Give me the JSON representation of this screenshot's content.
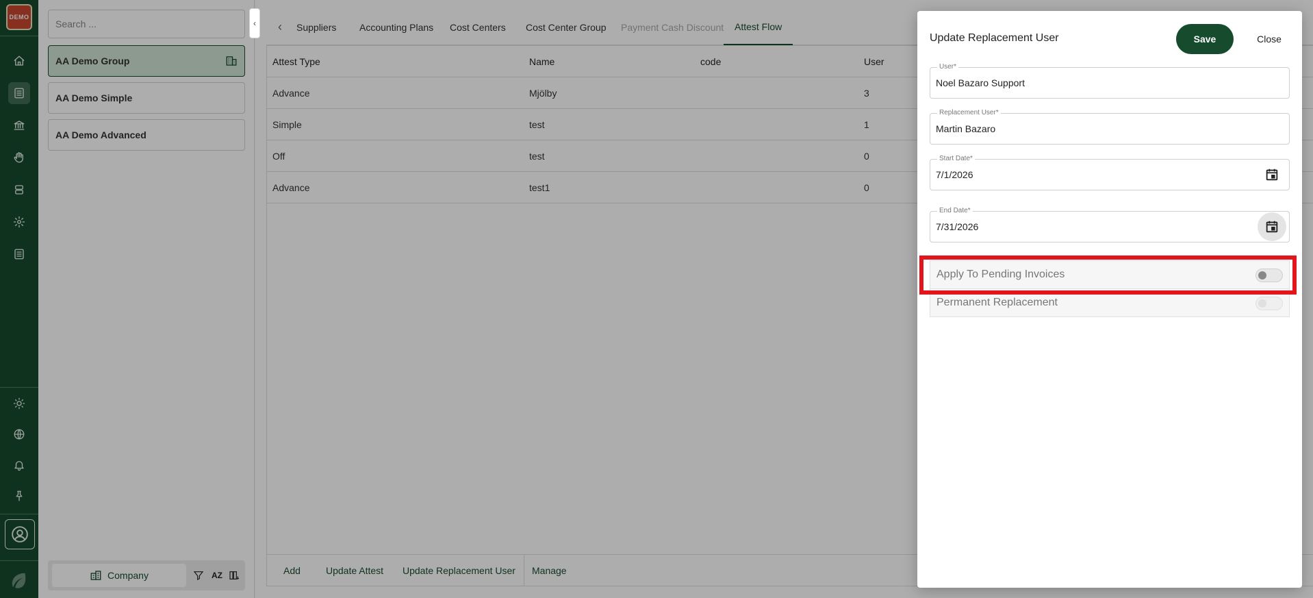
{
  "rail": {
    "logo_text": "DEMO",
    "top_icons": [
      "home-icon",
      "document-icon",
      "bank-icon",
      "hand-icon",
      "database-icon",
      "gear-icon",
      "list-icon"
    ],
    "bottom_icons": [
      "sun-icon",
      "globe-icon",
      "bell-icon",
      "pin-icon"
    ],
    "active_icon": "document-icon"
  },
  "list": {
    "search_placeholder": "Search ...",
    "collapse_glyph": "‹",
    "companies": [
      {
        "name": "AA Demo Group",
        "selected": true
      },
      {
        "name": "AA Demo Simple",
        "selected": false
      },
      {
        "name": "AA Demo Advanced",
        "selected": false
      }
    ],
    "footer": {
      "company_label": "Company",
      "sort_label": "AZ"
    }
  },
  "tabs": {
    "prev_glyph": "‹",
    "items": [
      "Suppliers",
      "Accounting Plans",
      "Cost Centers",
      "Cost Center Group",
      "Payment Cash Discount",
      "Attest Flow"
    ],
    "active": "Attest Flow",
    "disabled": "Payment Cash Discount"
  },
  "table": {
    "columns": [
      "Attest Type",
      "Name",
      "code",
      "User"
    ],
    "rows": [
      [
        "Advance",
        "Mjölby",
        "",
        "3"
      ],
      [
        "Simple",
        "test",
        "",
        "1"
      ],
      [
        "Off",
        "test",
        "",
        "0"
      ],
      [
        "Advance",
        "test1",
        "",
        "0"
      ]
    ]
  },
  "actions": [
    "Add",
    "Update Attest",
    "Update Replacement User",
    "Manage"
  ],
  "dialog": {
    "title": "Update Replacement User",
    "save_label": "Save",
    "close_label": "Close",
    "fields": {
      "user": {
        "label": "User*",
        "value": "Noel Bazaro Support"
      },
      "replacement_user": {
        "label": "Replacement User*",
        "value": "Martin Bazaro"
      },
      "start_date": {
        "label": "Start Date*",
        "value": "7/1/2026"
      },
      "end_date": {
        "label": "End Date*",
        "value": "7/31/2026"
      }
    },
    "toggles": {
      "apply_pending": {
        "label": "Apply To Pending Invoices",
        "on": false
      },
      "permanent": {
        "label": "Permanent Replacement",
        "on": false,
        "disabled": true
      }
    }
  },
  "colors": {
    "brand": "#174b2e",
    "highlight": "#e2141c"
  }
}
